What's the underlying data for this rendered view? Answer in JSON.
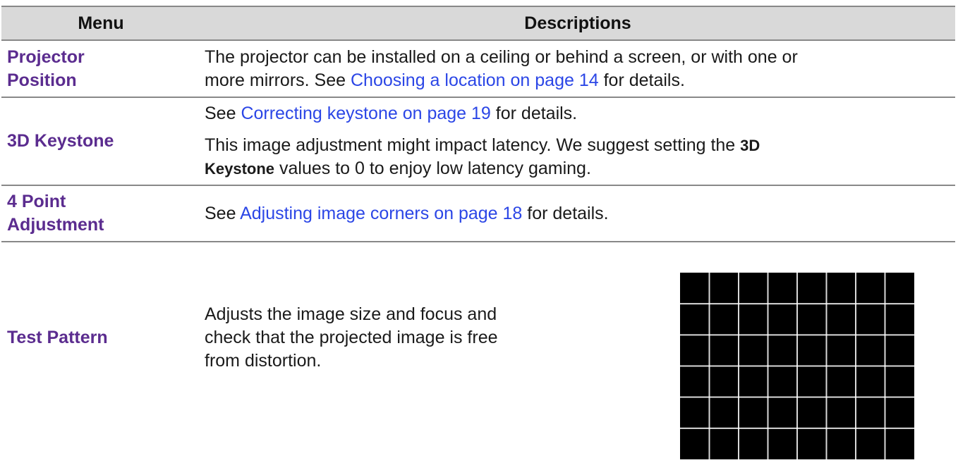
{
  "table": {
    "headers": {
      "menu": "Menu",
      "descriptions": "Descriptions"
    },
    "rows": {
      "projector_position": {
        "menu_line1": "Projector",
        "menu_line2": "Position",
        "desc_line1": "The projector can be installed on a ceiling or behind a screen, or with one or",
        "desc_line2_pre": "more mirrors. See ",
        "desc_link": "Choosing a location on page 14",
        "desc_post": " for details."
      },
      "keystone_3d": {
        "menu": "3D Keystone",
        "p1_pre": "See ",
        "p1_link": "Correcting keystone on page 19",
        "p1_post": " for details.",
        "p2_pre": "This image adjustment might impact latency. We suggest setting the ",
        "p2_bold1": "3D",
        "p2_bold2": "Keystone",
        "p2_post": " values to 0 to enjoy low latency gaming."
      },
      "four_point": {
        "menu_line1": "4 Point",
        "menu_line2": "Adjustment",
        "desc_pre": "See ",
        "desc_link": "Adjusting image corners on page 18",
        "desc_post": " for details."
      },
      "test_pattern": {
        "menu": "Test Pattern",
        "desc": "Adjusts the image size and focus and check that the projected image is free from distortion."
      }
    }
  },
  "test_pattern_image": {
    "columns": 8,
    "rows": 6,
    "background": "#000000",
    "line_color": "#ffffff"
  },
  "colors": {
    "menu_label": "#5b2c8f",
    "link": "#2b46e6",
    "header_bg": "#d9d9d9",
    "rule": "#888888"
  }
}
